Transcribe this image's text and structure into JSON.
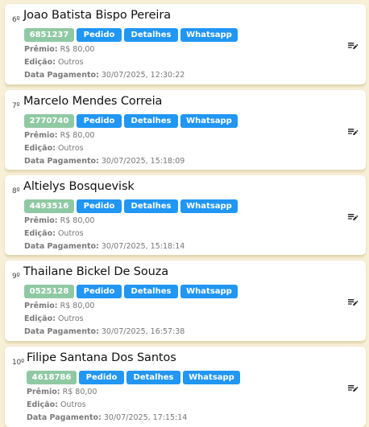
{
  "labels": {
    "premio": "Prêmio:",
    "edicao": "Edição:",
    "data_pagamento": "Data Pagamento:"
  },
  "buttons": {
    "pedido": "Pedido",
    "detalhes": "Detalhes",
    "whatsapp": "Whatsapp"
  },
  "icons": {
    "edit": "playlist-edit-icon"
  },
  "colors": {
    "background": "#f7efd6",
    "code_badge": "#8fc9a3",
    "action_button": "#2196f3"
  },
  "entries": [
    {
      "rank": "6º",
      "name": "Joao Batista Bispo Pereira",
      "code": "6851237",
      "premio": "R$ 80,00",
      "edicao": "Outros",
      "data_pagamento": "30/07/2025, 12:30:22"
    },
    {
      "rank": "7º",
      "name": "Marcelo Mendes Correia",
      "code": "2770740",
      "premio": "R$ 80,00",
      "edicao": "Outros",
      "data_pagamento": "30/07/2025, 15:18:09"
    },
    {
      "rank": "8º",
      "name": "Altielys Bosquevisk",
      "code": "4493516",
      "premio": "R$ 80,00",
      "edicao": "Outros",
      "data_pagamento": "30/07/2025, 15:18:14"
    },
    {
      "rank": "9º",
      "name": "Thailane Bickel De Souza",
      "code": "0525128",
      "premio": "R$ 80,00",
      "edicao": "Outros",
      "data_pagamento": "30/07/2025, 16:57:38"
    },
    {
      "rank": "10º",
      "name": "Filipe Santana Dos Santos",
      "code": "4618786",
      "premio": "R$ 80,00",
      "edicao": "Outros",
      "data_pagamento": "30/07/2025, 17:15:14"
    }
  ]
}
